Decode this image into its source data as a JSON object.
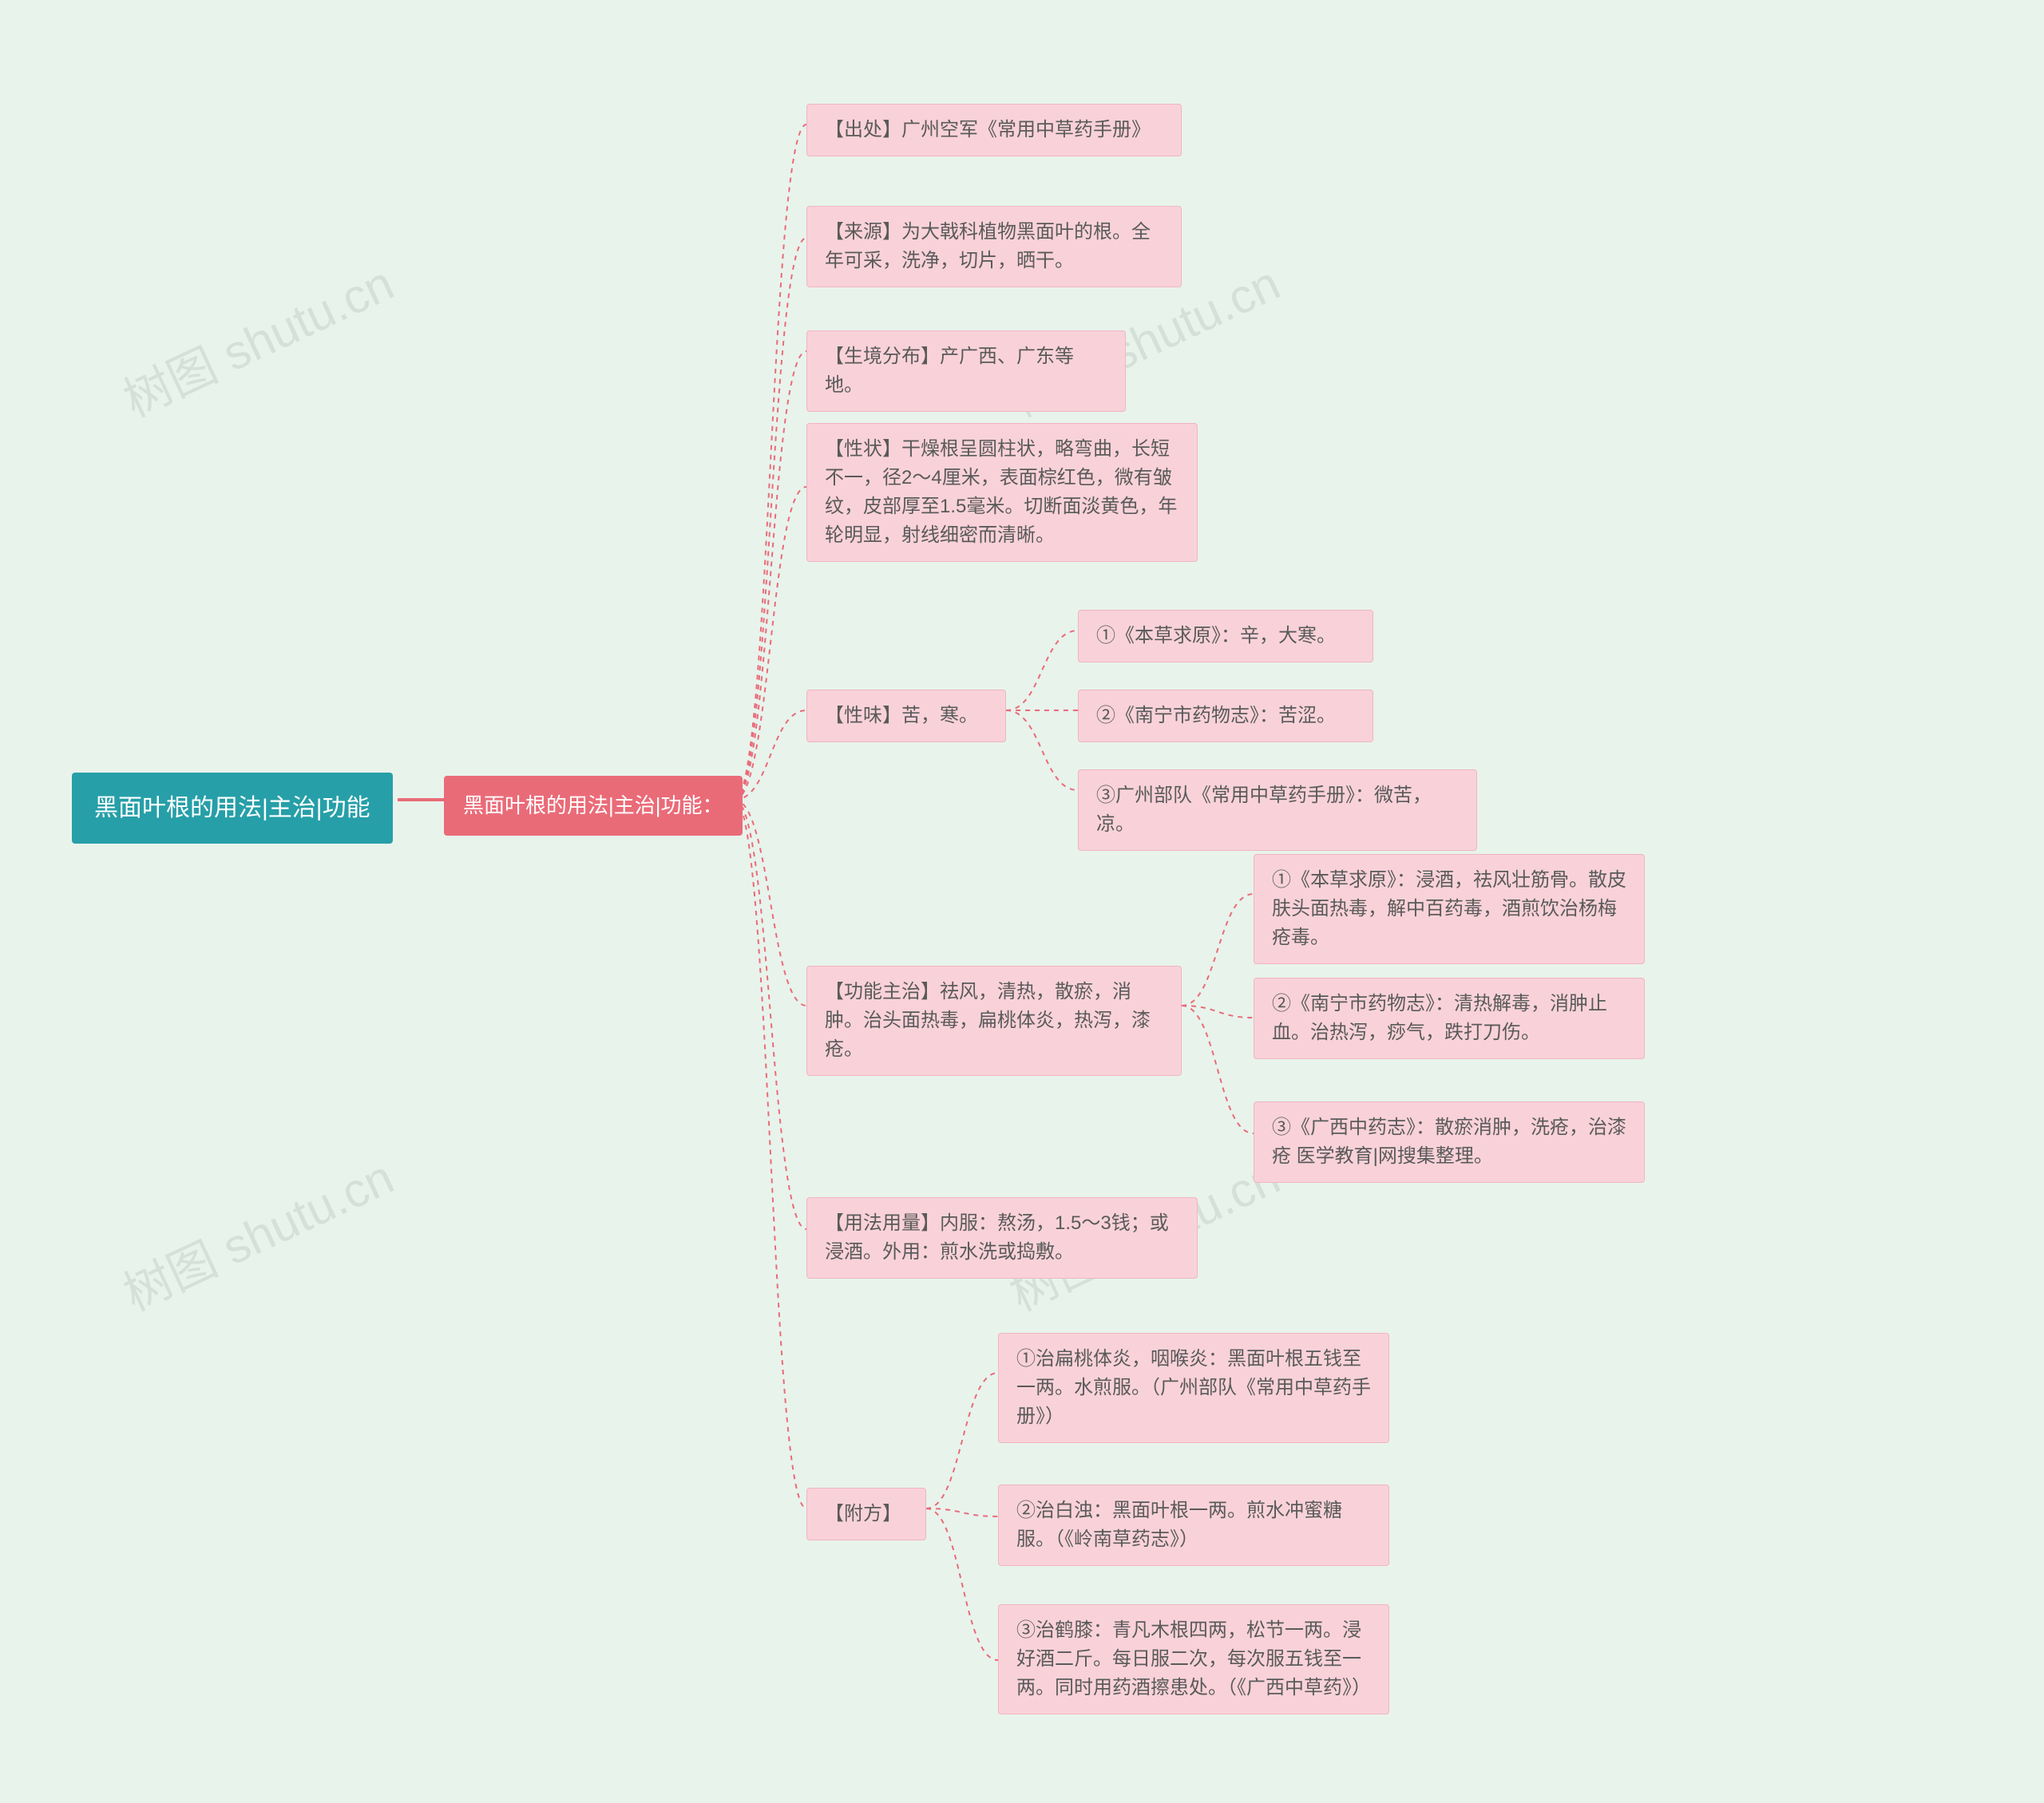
{
  "watermark": "树图 shutu.cn",
  "root": {
    "label": "黑面叶根的用法|主治|功能"
  },
  "sub": {
    "label": "黑面叶根的用法|主治|功能："
  },
  "sections": {
    "source_ref": "【出处】广州空军《常用中草药手册》",
    "origin": "【来源】为大戟科植物黑面叶的根。全年可采，洗净，切片，晒干。",
    "habitat": "【生境分布】产广西、广东等地。",
    "character": "【性状】干燥根呈圆柱状，略弯曲，长短不一，径2～4厘米，表面棕红色，微有皱纹，皮部厚至1.5毫米。切断面淡黄色，年轮明显，射线细密而清晰。",
    "taste": {
      "label": "【性味】苦，寒。",
      "items": [
        "①《本草求原》：辛，大寒。",
        "②《南宁市药物志》：苦涩。",
        "③广州部队《常用中草药手册》：微苦，凉。"
      ]
    },
    "function": {
      "label": "【功能主治】祛风，清热，散瘀，消肿。治头面热毒，扁桃体炎，热泻，漆疮。",
      "items": [
        "①《本草求原》：浸酒，祛风壮筋骨。散皮肤头面热毒，解中百药毒，酒煎饮治杨梅疮毒。",
        "②《南宁市药物志》：清热解毒，消肿止血。治热泻，痧气，跌打刀伤。",
        "③《广西中药志》：散瘀消肿，洗疮，治漆疮 医学教育|网搜集整理。"
      ]
    },
    "dosage": "【用法用量】内服：熬汤，1.5～3钱；或浸酒。外用：煎水洗或捣敷。",
    "formula": {
      "label": "【附方】",
      "items": [
        "①治扁桃体炎，咽喉炎：黑面叶根五钱至一两。水煎服。（广州部队《常用中草药手册》）",
        "②治白浊：黑面叶根一两。煎水冲蜜糖服。（《岭南草药志》）",
        "③治鹤膝：青凡木根四两，松节一两。浸好酒二斤。每日服二次，每次服五钱至一两。同时用药酒擦患处。（《广西中草药》）"
      ]
    }
  }
}
